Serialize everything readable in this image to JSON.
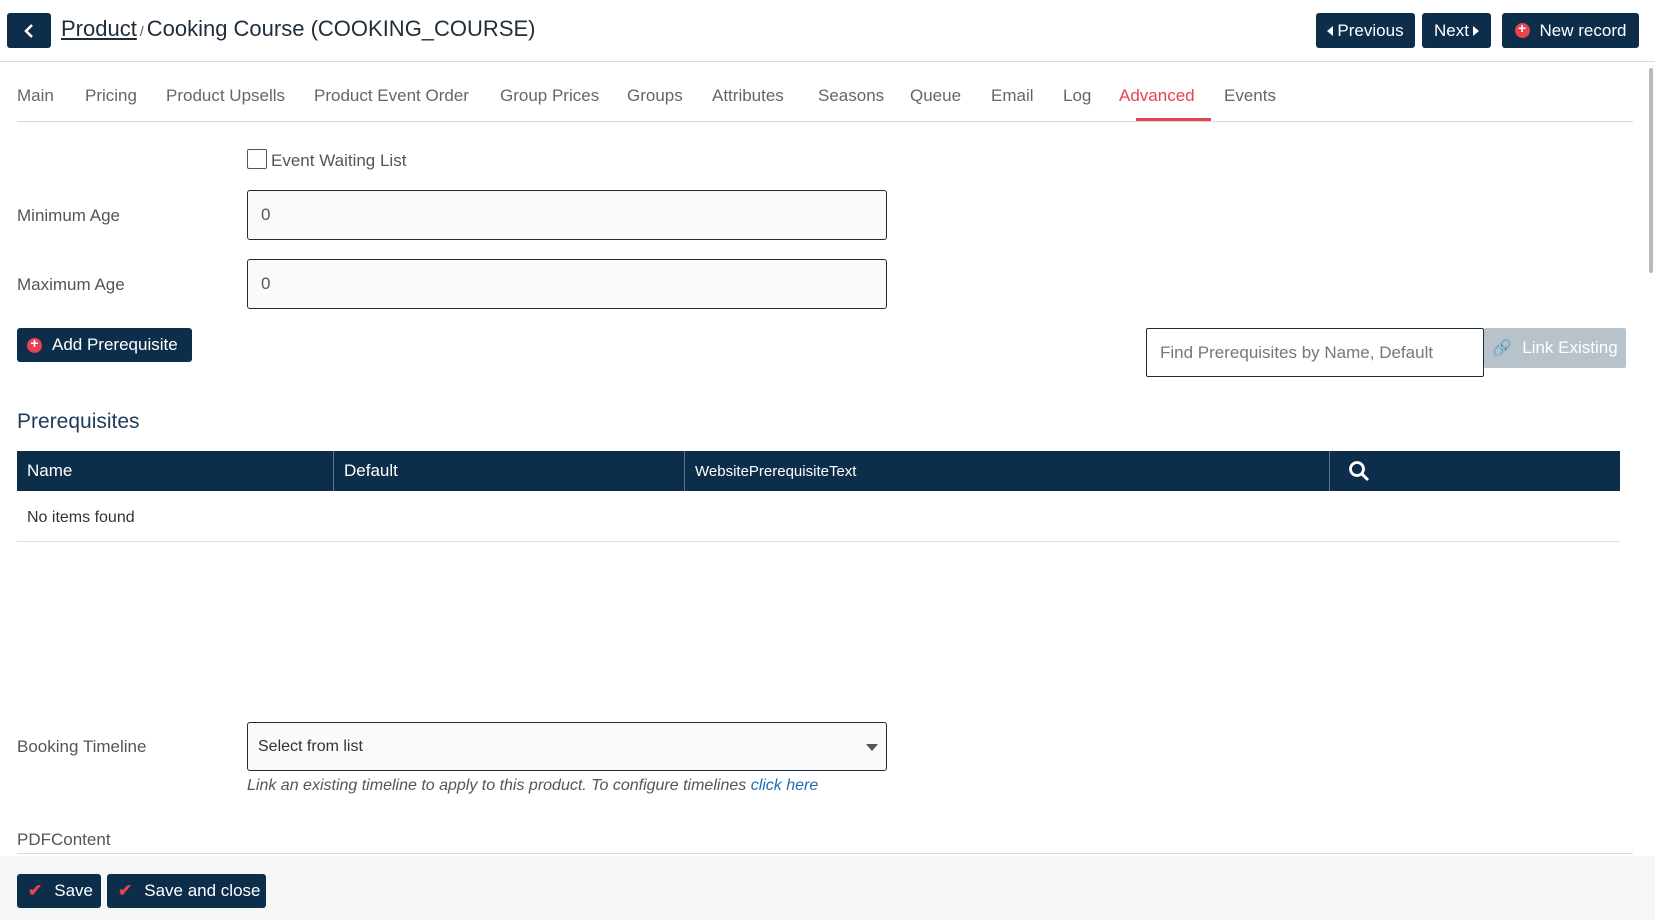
{
  "header": {
    "breadcrumb_root": "Product",
    "breadcrumb_sep": "/",
    "record_title": "Cooking Course (COOKING_COURSE)",
    "previous_label": "Previous",
    "next_label": "Next",
    "new_record_label": "New record"
  },
  "tabs": [
    {
      "label": "Main"
    },
    {
      "label": "Pricing"
    },
    {
      "label": "Product Upsells"
    },
    {
      "label": "Product Event Order"
    },
    {
      "label": "Group Prices"
    },
    {
      "label": "Groups"
    },
    {
      "label": "Attributes"
    },
    {
      "label": "Seasons"
    },
    {
      "label": "Queue"
    },
    {
      "label": "Email"
    },
    {
      "label": "Log"
    },
    {
      "label": "Advanced",
      "active": true
    },
    {
      "label": "Events"
    }
  ],
  "form": {
    "event_waiting_list_label": "Event Waiting List",
    "event_waiting_list_checked": false,
    "minimum_age_label": "Minimum Age",
    "minimum_age_value": "0",
    "maximum_age_label": "Maximum Age",
    "maximum_age_value": "0",
    "booking_timeline_label": "Booking Timeline",
    "booking_timeline_value": "Select from list",
    "booking_timeline_help": "Link an existing timeline to apply to this product. To configure timelines ",
    "booking_timeline_help_link": "click here",
    "pdf_content_label": "PDFContent"
  },
  "prerequisites": {
    "add_label": "Add Prerequisite",
    "find_placeholder": "Find Prerequisites by Name, Default",
    "link_existing_label": "Link Existing",
    "title": "Prerequisites",
    "columns": [
      "Name",
      "Default",
      "WebsitePrerequisiteText"
    ],
    "empty_text": "No items found"
  },
  "footer": {
    "save_label": "Save",
    "save_close_label": "Save and close"
  },
  "colors": {
    "primary": "#0d2e4a",
    "accent": "#e8414f",
    "link": "#1f6fb2"
  }
}
